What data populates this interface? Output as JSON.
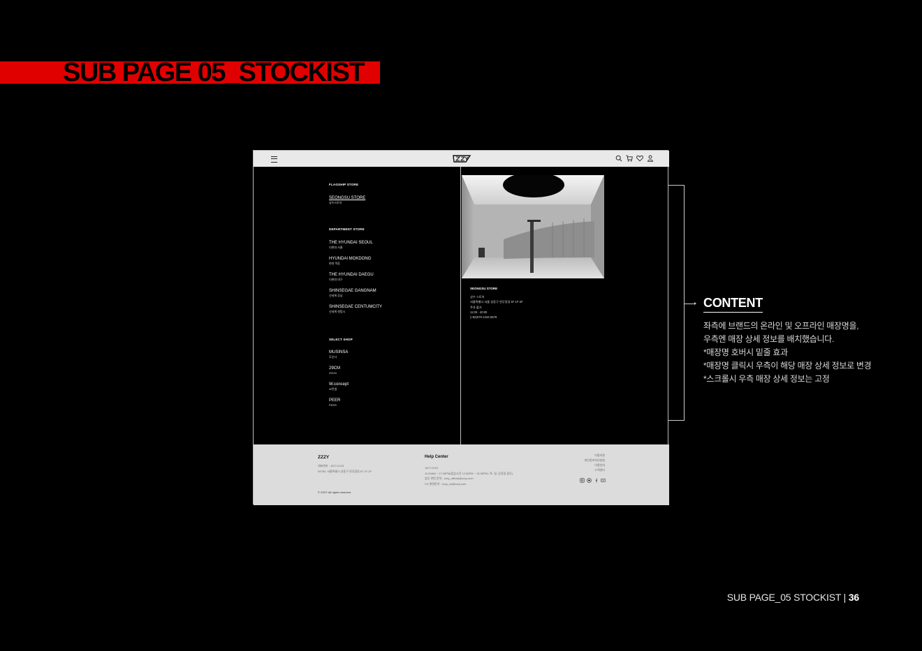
{
  "slide": {
    "heading": "SUB PAGE 05_STOCKIST",
    "accent_color": "#e10000",
    "footer_label": "SUB PAGE_05 STOCKIST",
    "footer_sep": " | ",
    "page_number": "36"
  },
  "mockup": {
    "header": {
      "menu_icon": "hamburger-menu-icon",
      "logo_icon": "zzzy-logo",
      "icons": [
        "search-icon",
        "cart-icon",
        "heart-icon",
        "user-icon"
      ]
    },
    "sections": [
      {
        "title": "FLAGSHIP STORE",
        "stores": [
          {
            "en": "SEONGSU STORE",
            "ko": "성수스토어",
            "active": true
          }
        ]
      },
      {
        "title": "DEPARTMENT STORE",
        "stores": [
          {
            "en": "THE HYUNDAI SEOUL",
            "ko": "더현대 서울"
          },
          {
            "en": "HYUNDAI MOKDONG",
            "ko": "현대 목동"
          },
          {
            "en": "THE HYUNDAI DAEGU",
            "ko": "더현대 대구"
          },
          {
            "en": "SHINSEGAE GANGNAM",
            "ko": "신세계 강남"
          },
          {
            "en": "SHINSEGAE CENTUMCITY",
            "ko": "신세계 센텀시"
          }
        ]
      },
      {
        "title": "SELECT SHOP",
        "stores": [
          {
            "en": "MUSINSA",
            "ko": "무신사"
          },
          {
            "en": "29CM",
            "ko": "29CM"
          },
          {
            "en": "W.concept",
            "ko": "W컨셉"
          },
          {
            "en": "PEER",
            "ko": "PEER"
          }
        ]
      }
    ],
    "detail": {
      "title": "SEONGSU STORE",
      "lines": [
        "성수 스토어",
        "서울특별시 서울 성동구 연무장길 87 1F-2F",
        "주차 불가",
        "11:00 - 20:00",
        "(+82)070-1234-5678"
      ]
    },
    "footer": {
      "brand": "ZZZY",
      "left_lines": [
        "대표번호 : 1677-0123",
        "04783, 서울특별시 성동구 연무장길 87 1F-2F"
      ],
      "copyright": "© ZZZY All rights reserved.",
      "help_title": "Help Center",
      "help_lines": [
        "1677-0123",
        "11:00AM ~ 17:00PM(점심시간 12:30PM ~ 13:30PM / 토, 일, 공휴일 휴무)",
        "업무 관련 문의 : zzzy_official@zzzy.com",
        "CS 관련문의 : zzzy_cs@zzzy.com"
      ],
      "links": [
        "이용약관",
        "개인정보처리방침",
        "이용안내",
        "고객센터"
      ],
      "social_icons": [
        "instagram-icon",
        "kakao-icon",
        "facebook-icon",
        "youtube-icon"
      ]
    }
  },
  "annotation": {
    "title": "CONTENT",
    "lines": [
      "좌측에 브랜드의 온라인 및 오프라인 매장명을,",
      "우측엔 매장 상세 정보를 배치했습니다.",
      "*매장명 호버시 밑줄 효과",
      "*매장명 클릭시 우측이 해당 매장 상세 정보로 변경",
      "*스크롤시 우측 매장 상세 정보는 고정"
    ]
  }
}
